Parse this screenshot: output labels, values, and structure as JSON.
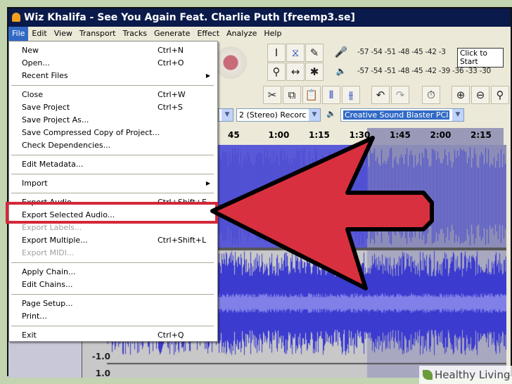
{
  "window": {
    "title": "Wiz Khalifa - See You Again Feat. Charlie Puth [freemp3.se]"
  },
  "menubar": [
    "File",
    "Edit",
    "View",
    "Transport",
    "Tracks",
    "Generate",
    "Effect",
    "Analyze",
    "Help"
  ],
  "file_menu": [
    {
      "label": "New",
      "shortcut": "Ctrl+N"
    },
    {
      "label": "Open...",
      "shortcut": "Ctrl+O"
    },
    {
      "label": "Recent Files",
      "submenu": true
    },
    {
      "sep": true
    },
    {
      "label": "Close",
      "shortcut": "Ctrl+W"
    },
    {
      "label": "Save Project",
      "shortcut": "Ctrl+S"
    },
    {
      "label": "Save Project As..."
    },
    {
      "label": "Save Compressed Copy of Project..."
    },
    {
      "label": "Check Dependencies..."
    },
    {
      "sep": true
    },
    {
      "label": "Edit Metadata..."
    },
    {
      "sep": true
    },
    {
      "label": "Import",
      "submenu": true
    },
    {
      "sep": true
    },
    {
      "label": "Export Audio...",
      "shortcut": "Ctrl+Shift+E"
    },
    {
      "label": "Export Selected Audio...",
      "highlighted": true
    },
    {
      "label": "Export Labels...",
      "disabled": true
    },
    {
      "label": "Export Multiple...",
      "shortcut": "Ctrl+Shift+L"
    },
    {
      "label": "Export MIDI...",
      "disabled": true
    },
    {
      "sep": true
    },
    {
      "label": "Apply Chain..."
    },
    {
      "label": "Edit Chains..."
    },
    {
      "sep": true
    },
    {
      "label": "Page Setup..."
    },
    {
      "label": "Print..."
    },
    {
      "sep": true
    },
    {
      "label": "Exit",
      "shortcut": "Ctrl+Q"
    }
  ],
  "meters": {
    "record": "-57 -54 -51 -48 -45 -42 -3",
    "playback": "-57 -54 -51 -48 -45 -42 -39 -36 -33 -30",
    "tooltip": "Click to Start"
  },
  "devices": {
    "channels": "2 (Stereo) Recorc",
    "output": "Creative Sound Blaster PCI"
  },
  "ruler": [
    "45",
    "1:00",
    "1:15",
    "1:30",
    "1:45",
    "2:00",
    "2:15"
  ],
  "scale": {
    "bottom": "-1.0",
    "top": "1.0"
  },
  "colors": {
    "highlight": "#d3283a",
    "arrow": "#d9303f",
    "waveform": "#3b3bd0",
    "selection": "#316ac5"
  },
  "watermark": "Healthy Living"
}
